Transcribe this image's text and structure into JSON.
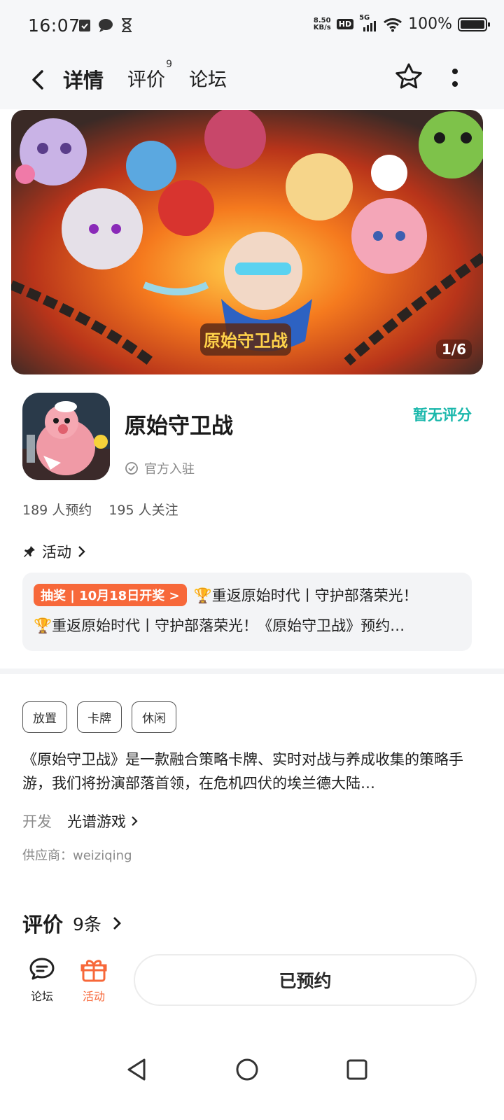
{
  "status_bar": {
    "time": "16:07",
    "speed_value": "8.50",
    "speed_unit": "KB/s",
    "hd": "HD",
    "network": "5G",
    "battery": "100%"
  },
  "nav": {
    "tabs": [
      {
        "label": "详情",
        "active": true
      },
      {
        "label": "评价",
        "badge": "9"
      },
      {
        "label": "论坛"
      }
    ]
  },
  "banner": {
    "title_art": "原始守卫战",
    "counter": "1/6"
  },
  "app": {
    "name": "原始守卫战",
    "rating": "暂无评分",
    "official": "官方入驻",
    "reservations": "189 人预约",
    "followers": "195 人关注"
  },
  "activity": {
    "label": "活动",
    "badge": "抽奖 | 10月18日开奖 >",
    "line1": "🏆重返原始时代丨守护部落荣光！",
    "line2": "🏆重返原始时代丨守护部落荣光！《原始守卫战》预约…"
  },
  "tags": [
    "放置",
    "卡牌",
    "休闲"
  ],
  "description": "《原始守卫战》是一款融合策略卡牌、实时对战与养成收集的策略手游，我们将扮演部落首领，在危机四伏的埃兰德大陆…",
  "developer": {
    "label": "开发",
    "name": "光谱游戏"
  },
  "supplier": "供应商：weiziqing",
  "reviews": {
    "title": "评价",
    "count": "9条"
  },
  "actions": {
    "forum": "论坛",
    "activity": "活动",
    "reserve_button": "已预约"
  },
  "colors": {
    "accent": "#1ec4b8",
    "rating": "#19b7ab",
    "activity_orange": "#f7683a"
  }
}
